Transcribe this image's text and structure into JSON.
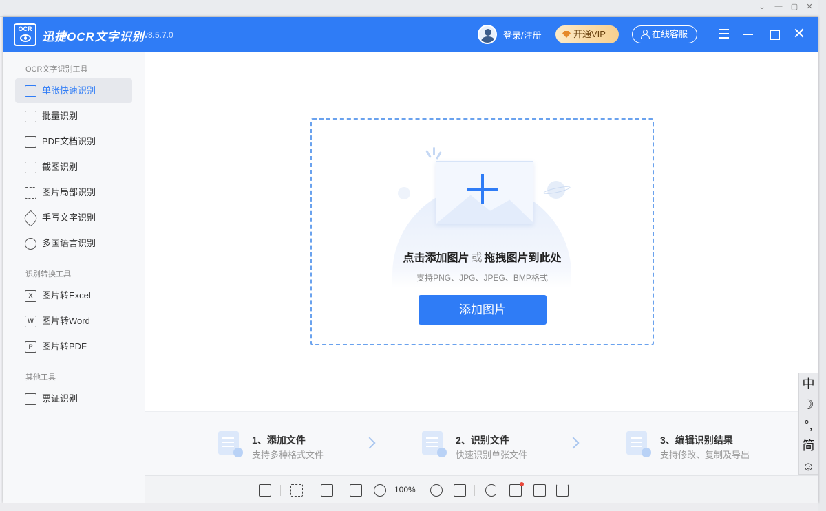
{
  "app": {
    "title": "迅捷OCR文字识别",
    "version": "v8.5.7.0",
    "logo_text": "OCR",
    "accent_color": "#2f7cf6"
  },
  "header": {
    "login_label": "登录/注册",
    "vip_label": "开通VIP",
    "service_label": "在线客服"
  },
  "sidebar": {
    "sections": [
      {
        "title": "OCR文字识别工具",
        "items": [
          {
            "label": "单张快速识别",
            "icon": "lightning-image-icon",
            "active": true
          },
          {
            "label": "批量识别",
            "icon": "stacked-pages-icon"
          },
          {
            "label": "PDF文档识别",
            "icon": "pdf-file-icon"
          },
          {
            "label": "截图识别",
            "icon": "crop-icon"
          },
          {
            "label": "图片局部识别",
            "icon": "partial-select-icon"
          },
          {
            "label": "手写文字识别",
            "icon": "pen-nib-icon"
          },
          {
            "label": "多国语言识别",
            "icon": "globe-icon"
          }
        ]
      },
      {
        "title": "识别转换工具",
        "items": [
          {
            "label": "图片转Excel",
            "icon": "excel-x-icon",
            "glyph": "X"
          },
          {
            "label": "图片转Word",
            "icon": "word-w-icon",
            "glyph": "W"
          },
          {
            "label": "图片转PDF",
            "icon": "pdf-p-icon",
            "glyph": "P"
          }
        ]
      },
      {
        "title": "其他工具",
        "items": [
          {
            "label": "票证识别",
            "icon": "ticket-card-icon"
          }
        ]
      }
    ]
  },
  "upload": {
    "heading_click": "点击添加图片",
    "heading_or": "或",
    "heading_drag": "拖拽图片到此处",
    "formats": "支持PNG、JPG、JPEG、BMP格式",
    "button": "添加图片"
  },
  "steps": [
    {
      "title": "1、添加文件",
      "desc": "支持多种格式文件"
    },
    {
      "title": "2、识别文件",
      "desc": "快速识别单张文件"
    },
    {
      "title": "3、编辑识别结果",
      "desc": "支持修改、复制及导出"
    }
  ],
  "toolbar": {
    "zoom": "100%",
    "icons": [
      "layout-icon",
      "fit-icon",
      "compare-icon",
      "fullscreen-icon",
      "zoom-out-icon",
      "zoom-in-icon",
      "actual-size-icon",
      "rotate-icon",
      "edit-icon",
      "crop-icon",
      "download-icon"
    ]
  },
  "ime": {
    "items": [
      "中",
      "☽",
      "°,",
      "简",
      "☺"
    ]
  }
}
